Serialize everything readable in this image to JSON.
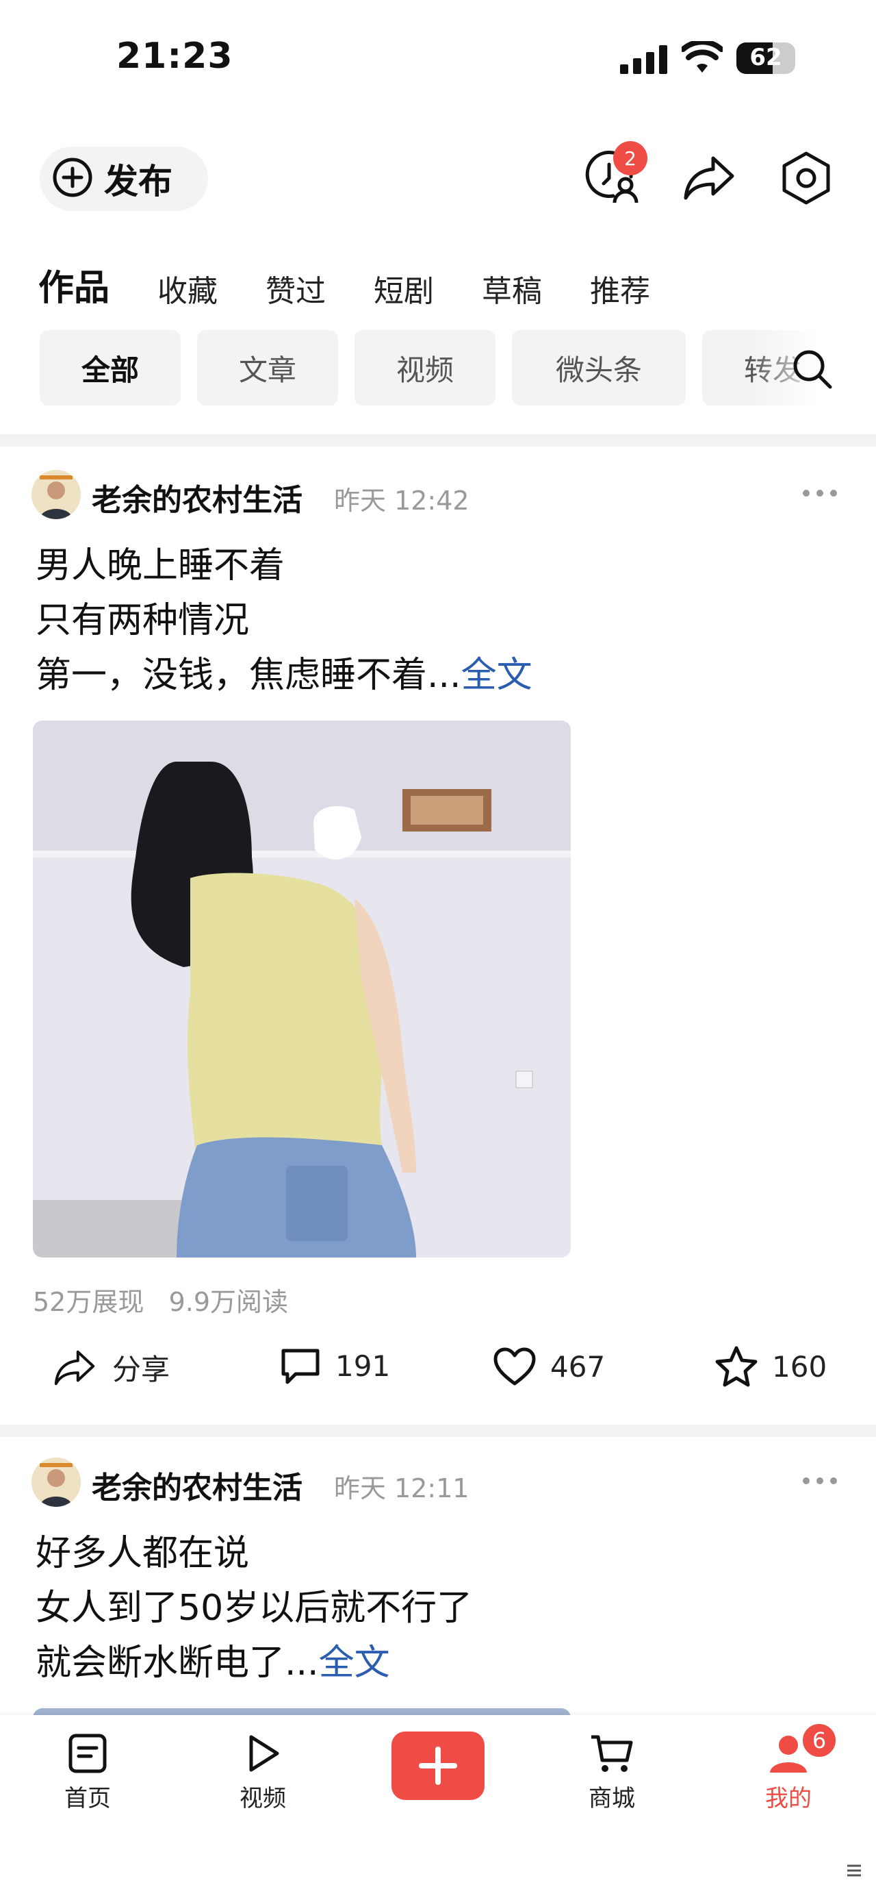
{
  "status_bar": {
    "time": "21:23",
    "battery": "62",
    "battery_level": 0.62
  },
  "header": {
    "publish_label": "发布",
    "messages_badge": "2"
  },
  "tabs": [
    "作品",
    "收藏",
    "赞过",
    "短剧",
    "草稿",
    "推荐"
  ],
  "filters": [
    "全部",
    "文章",
    "视频",
    "微头条",
    "转发"
  ],
  "posts": [
    {
      "author": "老余的农村生活",
      "time": "昨天 12:42",
      "lines": [
        "男人晚上睡不着",
        "只有两种情况",
        "第一，没钱，焦虑睡不着..."
      ],
      "more": "全文",
      "impressions": "52万展现",
      "reads": "9.9万阅读",
      "share_label": "分享",
      "comments": "191",
      "likes": "467",
      "favorites": "160"
    },
    {
      "author": "老余的农村生活",
      "time": "昨天 12:11",
      "lines": [
        "好多人都在说",
        "女人到了50岁以后就不行了",
        "就会断水断电了..."
      ],
      "more": "全文"
    }
  ],
  "bottom_nav": {
    "home": "首页",
    "video": "视频",
    "mall": "商城",
    "mine": "我的",
    "mine_badge": "6"
  },
  "colors": {
    "accent": "#f04c46",
    "link": "#2a5db0"
  }
}
